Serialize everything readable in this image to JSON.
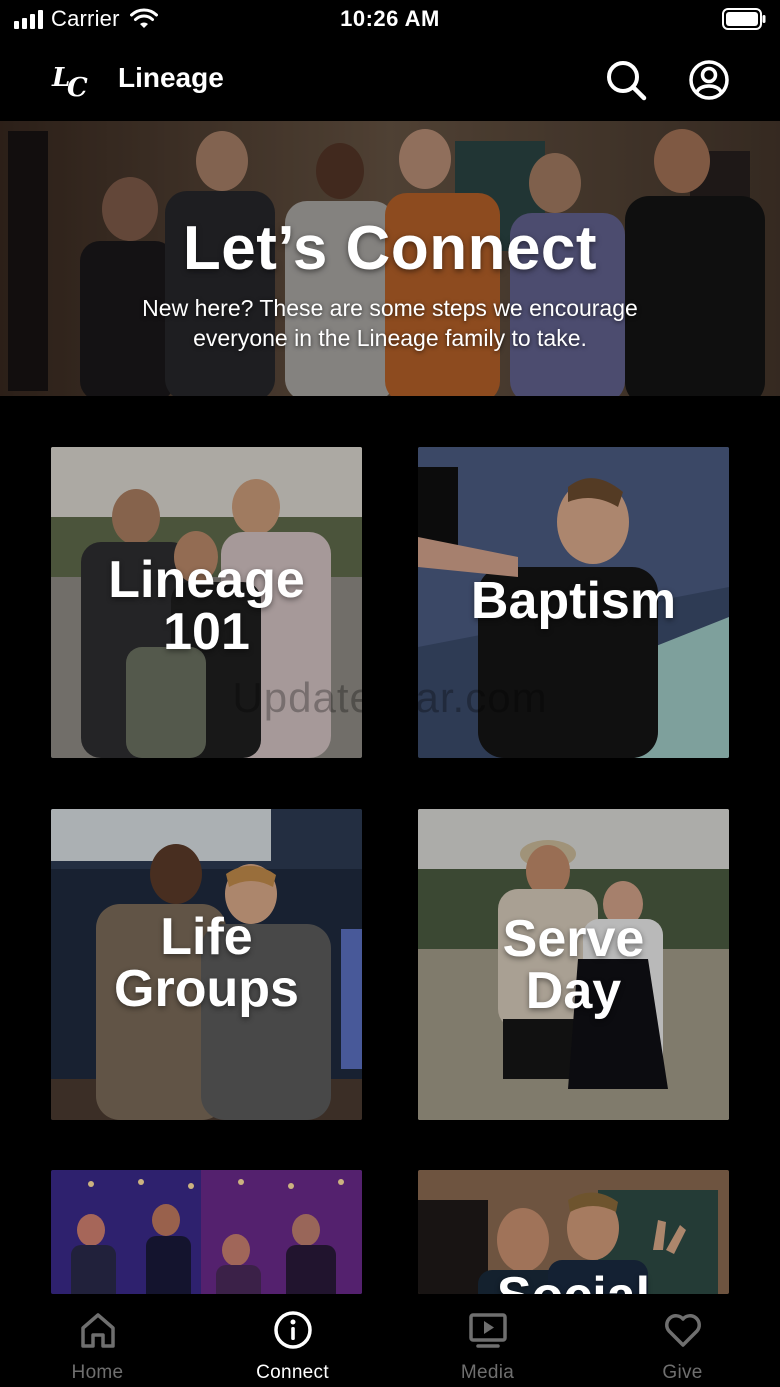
{
  "status_bar": {
    "carrier": "Carrier",
    "time": "10:26 AM"
  },
  "nav": {
    "title": "Lineage",
    "logo_icon": "lineage-lc-logo",
    "search_icon": "search-icon",
    "profile_icon": "profile-icon"
  },
  "hero": {
    "title": "Let’s Connect",
    "subtitle": "New here? These are some steps we encourage everyone in the Lineage family to take."
  },
  "tiles": [
    {
      "line1": "Lineage",
      "line2": "101"
    },
    {
      "line1": "Baptism",
      "line2": ""
    },
    {
      "line1": "Life",
      "line2": "Groups"
    },
    {
      "line1": "Serve",
      "line2": "Day"
    },
    {
      "line1": "",
      "line2": ""
    },
    {
      "line1": "Social",
      "line2": ""
    }
  ],
  "watermark": "UpdateStar.com",
  "tab_bar": {
    "items": [
      {
        "label": "Home",
        "icon": "home-icon",
        "active": false
      },
      {
        "label": "Connect",
        "icon": "info-circle-icon",
        "active": true
      },
      {
        "label": "Media",
        "icon": "media-play-icon",
        "active": false
      },
      {
        "label": "Give",
        "icon": "heart-icon",
        "active": false
      }
    ]
  },
  "colors": {
    "background": "#000000",
    "text": "#ffffff",
    "tab_inactive": "#6f6f6f"
  }
}
